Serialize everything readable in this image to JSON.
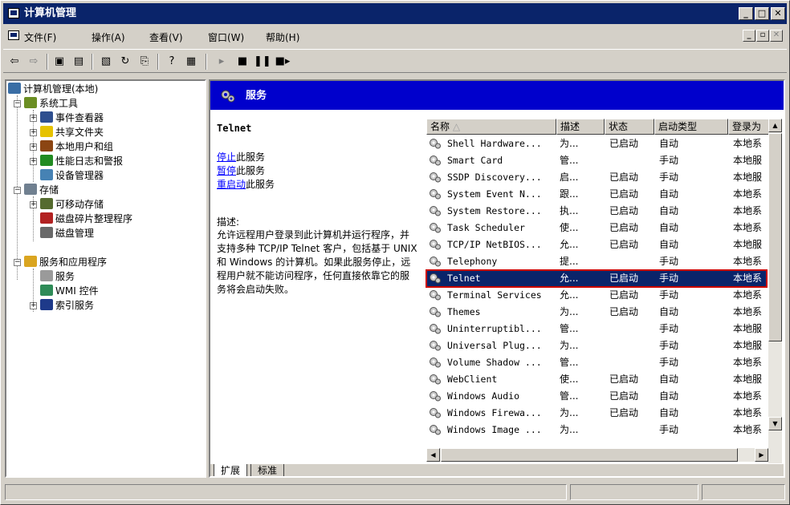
{
  "window": {
    "title": "计算机管理"
  },
  "menu": [
    "文件(F)",
    "操作(A)",
    "查看(V)",
    "窗口(W)",
    "帮助(H)"
  ],
  "toolbar_icons": [
    "back-icon",
    "forward-icon",
    "up-folder-icon",
    "show-tree-icon",
    "properties-icon",
    "refresh-icon",
    "export-icon",
    "help-icon",
    "console-icon",
    "play-icon",
    "stop-icon",
    "pause-icon",
    "restart-icon"
  ],
  "tree": {
    "root": "计算机管理(本地)",
    "items": [
      {
        "label": "系统工具"
      },
      {
        "label": "事件查看器"
      },
      {
        "label": "共享文件夹"
      },
      {
        "label": "本地用户和组"
      },
      {
        "label": "性能日志和警报"
      },
      {
        "label": "设备管理器"
      },
      {
        "label": "存储"
      },
      {
        "label": "可移动存储"
      },
      {
        "label": "磁盘碎片整理程序"
      },
      {
        "label": "磁盘管理"
      },
      {
        "label": "服务和应用程序"
      },
      {
        "label": "服务"
      },
      {
        "label": "WMI 控件"
      },
      {
        "label": "索引服务"
      }
    ]
  },
  "banner": {
    "title": "服务"
  },
  "detail": {
    "service_name": "Telnet",
    "stop_link": "停止",
    "stop_rest": "此服务",
    "pause_link": "暂停",
    "pause_rest": "此服务",
    "restart_link": "重启动",
    "restart_rest": "此服务",
    "desc_label": "描述:",
    "desc_text": "允许远程用户登录到此计算机并运行程序，并支持多种 TCP/IP Telnet 客户，包括基于 UNIX 和 Windows 的计算机。如果此服务停止，远程用户就不能访问程序，任何直接依靠它的服务将会启动失败。"
  },
  "columns": [
    "名称",
    "描述",
    "状态",
    "启动类型",
    "登录为"
  ],
  "services": [
    [
      "Shell Hardware...",
      "为...",
      "已启动",
      "自动",
      "本地系"
    ],
    [
      "Smart Card",
      "管...",
      "",
      "手动",
      "本地服"
    ],
    [
      "SSDP Discovery...",
      "启...",
      "已启动",
      "手动",
      "本地服"
    ],
    [
      "System Event N...",
      "跟...",
      "已启动",
      "自动",
      "本地系"
    ],
    [
      "System Restore...",
      "执...",
      "已启动",
      "自动",
      "本地系"
    ],
    [
      "Task Scheduler",
      "使...",
      "已启动",
      "自动",
      "本地系"
    ],
    [
      "TCP/IP NetBIOS...",
      "允...",
      "已启动",
      "自动",
      "本地服"
    ],
    [
      "Telephony",
      "提...",
      "",
      "手动",
      "本地系"
    ],
    [
      "Telnet",
      "允...",
      "已启动",
      "手动",
      "本地系"
    ],
    [
      "Terminal Services",
      "允...",
      "已启动",
      "手动",
      "本地系"
    ],
    [
      "Themes",
      "为...",
      "已启动",
      "自动",
      "本地系"
    ],
    [
      "Uninterruptibl...",
      "管...",
      "",
      "手动",
      "本地服"
    ],
    [
      "Universal Plug...",
      "为...",
      "",
      "手动",
      "本地服"
    ],
    [
      "Volume Shadow ...",
      "管...",
      "",
      "手动",
      "本地系"
    ],
    [
      "WebClient",
      "使...",
      "已启动",
      "自动",
      "本地服"
    ],
    [
      "Windows Audio",
      "管...",
      "已启动",
      "自动",
      "本地系"
    ],
    [
      "Windows Firewa...",
      "为...",
      "已启动",
      "自动",
      "本地系"
    ],
    [
      "Windows Image ...",
      "为...",
      "",
      "手动",
      "本地系"
    ]
  ],
  "selected_index": 8,
  "tabs": [
    "扩展",
    "标准"
  ],
  "colors": {
    "title_bar": "#0a246a",
    "banner": "#0000cc",
    "selection": "#0a246a",
    "highlight_box": "#cc0000",
    "link": "#0000ff"
  }
}
